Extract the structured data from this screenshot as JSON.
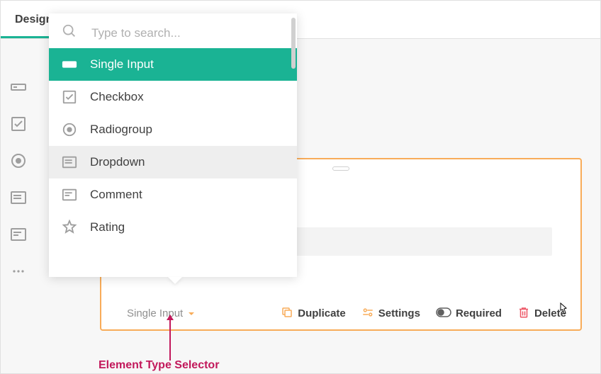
{
  "tabs": {
    "design": "Designer"
  },
  "search": {
    "placeholder": "Type to search..."
  },
  "options": [
    {
      "label": "Single Input",
      "icon": "single-input-icon",
      "state": "selected"
    },
    {
      "label": "Checkbox",
      "icon": "checkbox-icon",
      "state": ""
    },
    {
      "label": "Radiogroup",
      "icon": "radio-icon",
      "state": ""
    },
    {
      "label": "Dropdown",
      "icon": "dropdown-icon",
      "state": "hovered"
    },
    {
      "label": "Comment",
      "icon": "comment-icon",
      "state": ""
    },
    {
      "label": "Rating",
      "icon": "rating-icon",
      "state": ""
    }
  ],
  "type_selector": {
    "current": "Single Input"
  },
  "actions": {
    "duplicate": "Duplicate",
    "settings": "Settings",
    "required": "Required",
    "delete": "Delete"
  },
  "annotation": "Element Type Selector"
}
